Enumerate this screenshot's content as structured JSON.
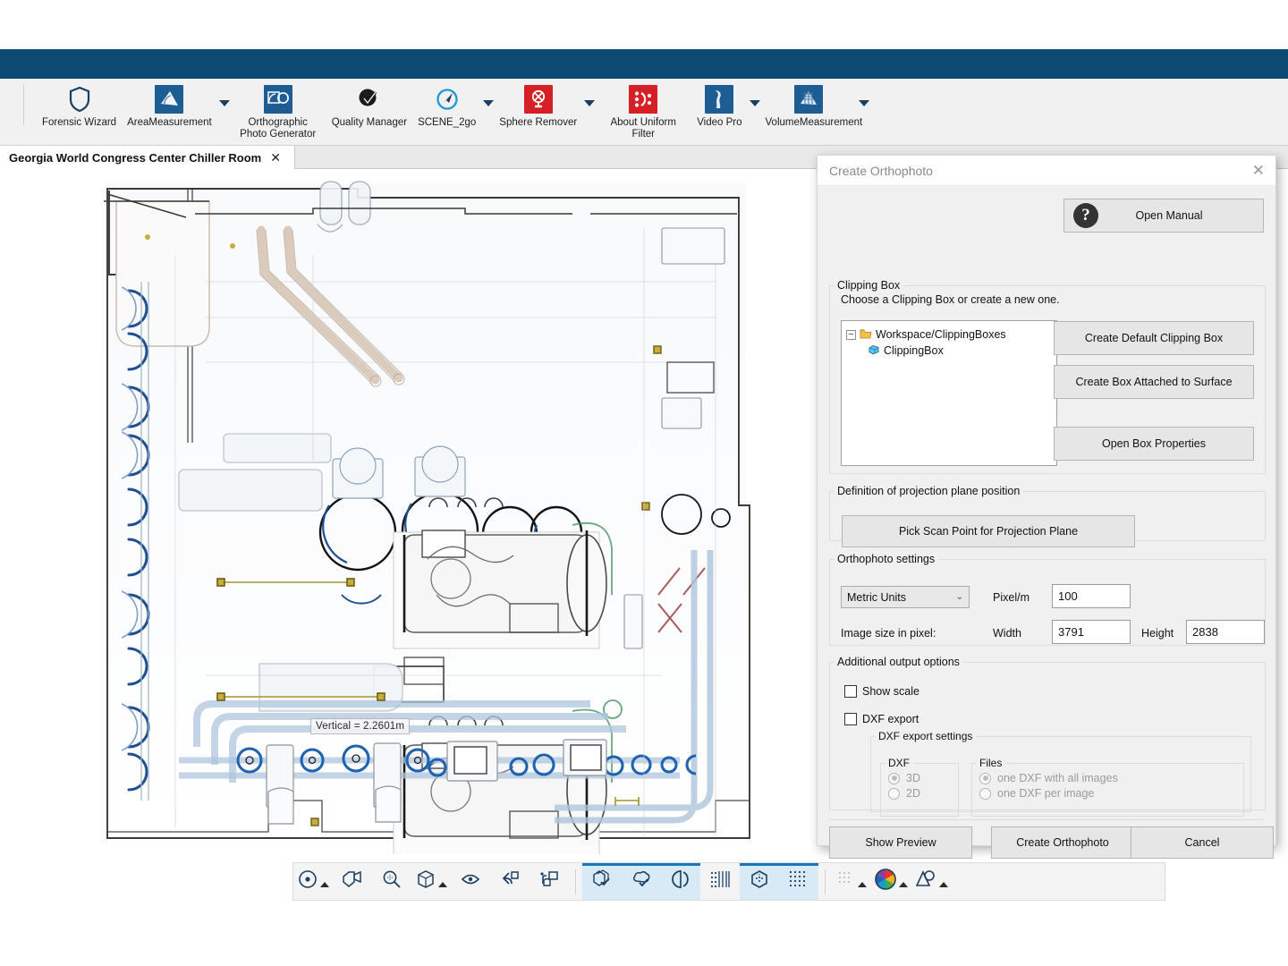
{
  "window": {
    "accent_color": "#0d4a73"
  },
  "ribbon": {
    "items": [
      {
        "label": "Forensic Wizard",
        "icon": "shield-icon",
        "caret": false
      },
      {
        "label": "AreaMeasurement",
        "icon": "area-measurement-icon",
        "caret": true
      },
      {
        "label": "Orthographic Photo Generator",
        "icon": "orthographic-photo-icon",
        "caret": false
      },
      {
        "label": "Quality Manager",
        "icon": "quality-manager-icon",
        "caret": false
      },
      {
        "label": "SCENE_2go",
        "icon": "scene-2go-icon",
        "caret": true
      },
      {
        "label": "Sphere Remover",
        "icon": "sphere-remover-icon",
        "caret": true
      },
      {
        "label": "About Uniform Filter",
        "icon": "uniform-filter-icon",
        "caret": false
      },
      {
        "label": "Video Pro",
        "icon": "video-pro-icon",
        "caret": true
      },
      {
        "label": "VolumeMeasurement",
        "icon": "volume-measurement-icon",
        "caret": true
      }
    ]
  },
  "tab": {
    "title": "Georgia World Congress Center Chiller Room",
    "close": "✕"
  },
  "viewport": {
    "measurement_label": "Vertical = 2.2601m"
  },
  "bottom_toolbar": {
    "buttons": [
      {
        "name": "set-center-point",
        "icon": "center-point-icon",
        "caret": true,
        "active": false
      },
      {
        "name": "camera-move",
        "icon": "camera-box-icon",
        "caret": false,
        "active": false
      },
      {
        "name": "zoom-tool",
        "icon": "magnifier-icon",
        "caret": false,
        "active": false
      },
      {
        "name": "view-cube",
        "icon": "cube-icon",
        "caret": true,
        "active": false
      },
      {
        "name": "rotate-view",
        "icon": "rotate-icon",
        "caret": false,
        "active": false
      },
      {
        "name": "undo-view",
        "icon": "undo-camera-icon",
        "caret": false,
        "active": false
      },
      {
        "name": "pick-camera",
        "icon": "hand-camera-icon",
        "caret": false,
        "active": false
      },
      {
        "name": "show-objects",
        "icon": "objects-check-icon",
        "caret": false,
        "active": true
      },
      {
        "name": "show-scans",
        "icon": "cloud-check-icon",
        "caret": false,
        "active": true
      },
      {
        "name": "clipping-toggle",
        "icon": "clipping-icon",
        "caret": false,
        "active": true
      },
      {
        "name": "grid-points",
        "icon": "grid-points-icon",
        "caret": false,
        "active": false
      },
      {
        "name": "clipping-box",
        "icon": "hex-box-icon",
        "caret": false,
        "active": true
      },
      {
        "name": "point-cloud",
        "icon": "point-cloud-icon",
        "caret": false,
        "active": true
      },
      {
        "name": "point-size",
        "icon": "dots-small-icon",
        "caret": true,
        "active": false
      },
      {
        "name": "color-mode",
        "icon": "color-wheel-icon",
        "caret": true,
        "active": false
      },
      {
        "name": "lighting-mode",
        "icon": "shading-icon",
        "caret": true,
        "active": false
      }
    ]
  },
  "dialog": {
    "title": "Create Orthophoto",
    "close_icon": "✕",
    "open_manual": {
      "label": "Open Manual",
      "icon": "question-mark-icon"
    },
    "clipping_box": {
      "legend": "Clipping Box",
      "hint": "Choose a Clipping Box or create a new one.",
      "tree": {
        "root": {
          "label": "Workspace/ClippingBoxes",
          "expander": "−",
          "icon": "folder-icon"
        },
        "child": {
          "label": "ClippingBox",
          "icon": "clipping-box-icon"
        }
      },
      "buttons": {
        "default": "Create Default Clipping Box",
        "attached": "Create Box Attached to Surface",
        "properties": "Open Box Properties"
      }
    },
    "projection": {
      "legend": "Definition of projection plane position",
      "pick_button": "Pick Scan Point for Projection Plane"
    },
    "ortho_settings": {
      "legend": "Orthophoto settings",
      "units_value": "Metric Units",
      "units_chevron": "⌄",
      "pixel_per_m_label": "Pixel/m",
      "pixel_per_m_value": "100",
      "image_size_label": "Image size in pixel:",
      "width_label": "Width",
      "width_value": "3791",
      "height_label": "Height",
      "height_value": "2838"
    },
    "additional": {
      "legend": "Additional output options",
      "show_scale": "Show scale",
      "dxf_export": "DXF export",
      "dxf_settings_legend": "DXF export settings",
      "dxf_legend": "DXF",
      "dxf_3d": "3D",
      "dxf_2d": "2D",
      "files_legend": "Files",
      "files_all": "one DXF with all images",
      "files_per": "one DXF per image"
    },
    "footer": {
      "preview": "Show Preview",
      "create": "Create Orthophoto",
      "cancel": "Cancel"
    }
  }
}
